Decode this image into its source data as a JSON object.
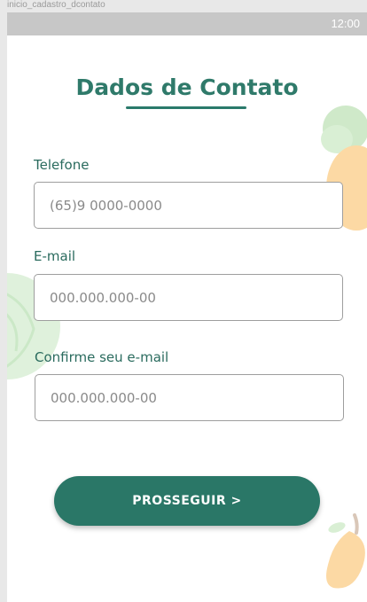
{
  "artboard": {
    "name": "inicio_cadastro_dcontato"
  },
  "status_bar": {
    "time": "12:00"
  },
  "header": {
    "title": "Dados de Contato"
  },
  "form": {
    "phone": {
      "label": "Telefone",
      "placeholder": "(65)9 0000-0000"
    },
    "email": {
      "label": "E-mail",
      "placeholder": "000.000.000-00"
    },
    "confirm_email": {
      "label": "Confirme seu e-mail",
      "placeholder": "000.000.000-00"
    }
  },
  "actions": {
    "proceed_label": "PROSSEGUIR >"
  },
  "colors": {
    "primary": "#2a7767",
    "title": "#2f7a6a",
    "label": "#2a6b5e",
    "status_bar": "#c7c7c7",
    "decor_cabbage": "#dff1dc",
    "decor_carrot": "#fcd9a4",
    "decor_mango": "#fcd9a4"
  },
  "icons": [
    "cabbage-illustration-icon",
    "carrot-illustration-icon",
    "mango-illustration-icon"
  ]
}
